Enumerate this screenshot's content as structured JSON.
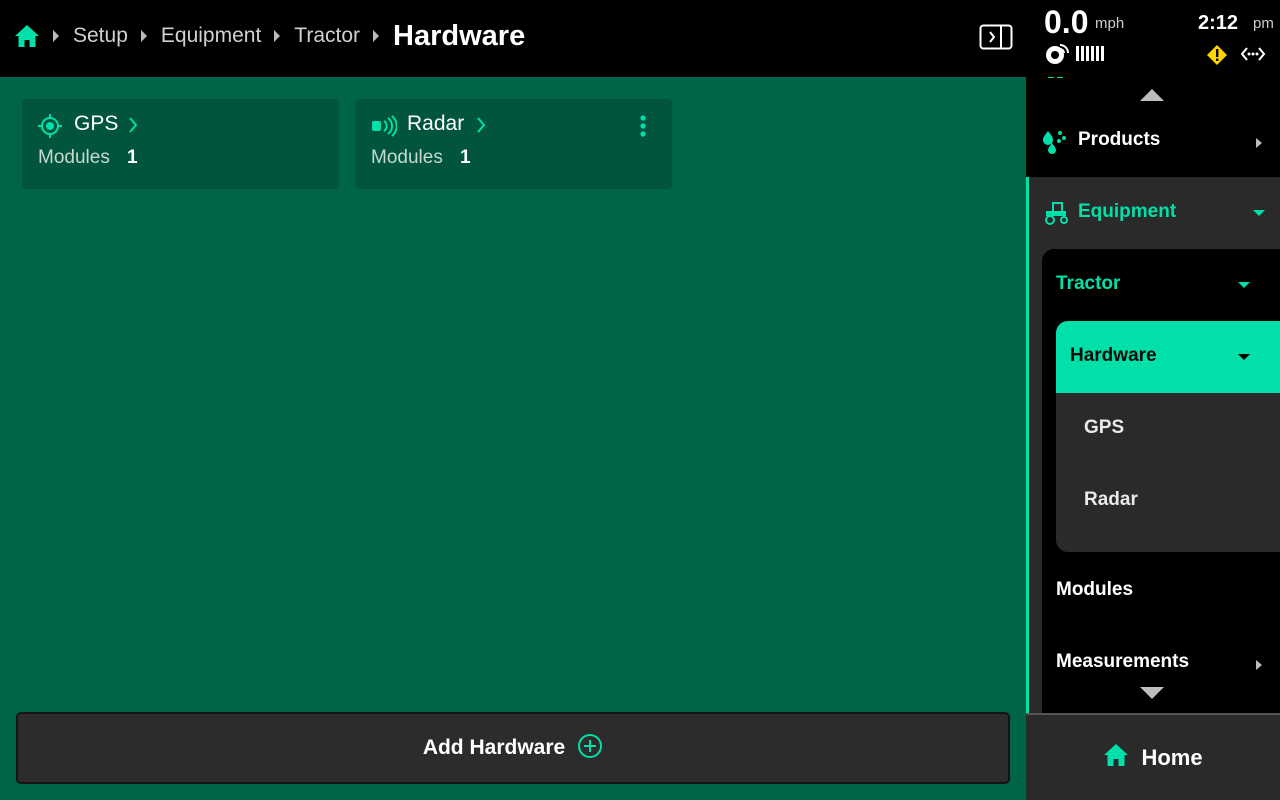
{
  "breadcrumb": {
    "items": [
      "Setup",
      "Equipment",
      "Tractor"
    ],
    "current": "Hardware"
  },
  "status": {
    "speed": "0.0",
    "speed_unit": "mph",
    "time": "2:12",
    "ampm": "pm"
  },
  "cards": [
    {
      "title": "GPS",
      "modules_label": "Modules",
      "modules_count": "1"
    },
    {
      "title": "Radar",
      "modules_label": "Modules",
      "modules_count": "1"
    }
  ],
  "add_button": {
    "label": "Add Hardware"
  },
  "sidebar": {
    "products": "Products",
    "equipment": "Equipment",
    "tractor": "Tractor",
    "hardware": "Hardware",
    "hardware_children": [
      "GPS",
      "Radar"
    ],
    "modules": "Modules",
    "measurements": "Measurements"
  },
  "home_button": {
    "label": "Home"
  },
  "colors": {
    "accent": "#00e0a8",
    "background": "#006548",
    "card": "#00553c",
    "warning": "#ffd400"
  }
}
